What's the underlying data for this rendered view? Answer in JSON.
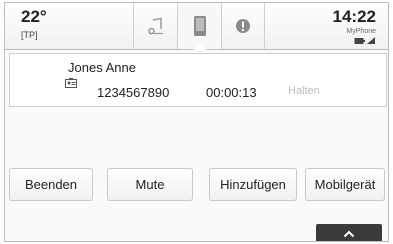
{
  "status": {
    "temperature": "22°",
    "traffic_program": "[TP]",
    "time": "14:22",
    "phone_name": "MyPhone"
  },
  "toolbar": {
    "icons": [
      "music-note-icon",
      "phone-icon",
      "info-icon"
    ],
    "active_index": 1
  },
  "call": {
    "caller_name": "Jones Anne",
    "number": "1234567890",
    "duration": "00:00:13",
    "hold_label": "Halten"
  },
  "buttons": {
    "end": "Beenden",
    "mute": "Mute",
    "add": "Hinzufügen",
    "mobile": "Mobilgerät"
  },
  "handle": {
    "icon": "chevron-up-icon"
  }
}
